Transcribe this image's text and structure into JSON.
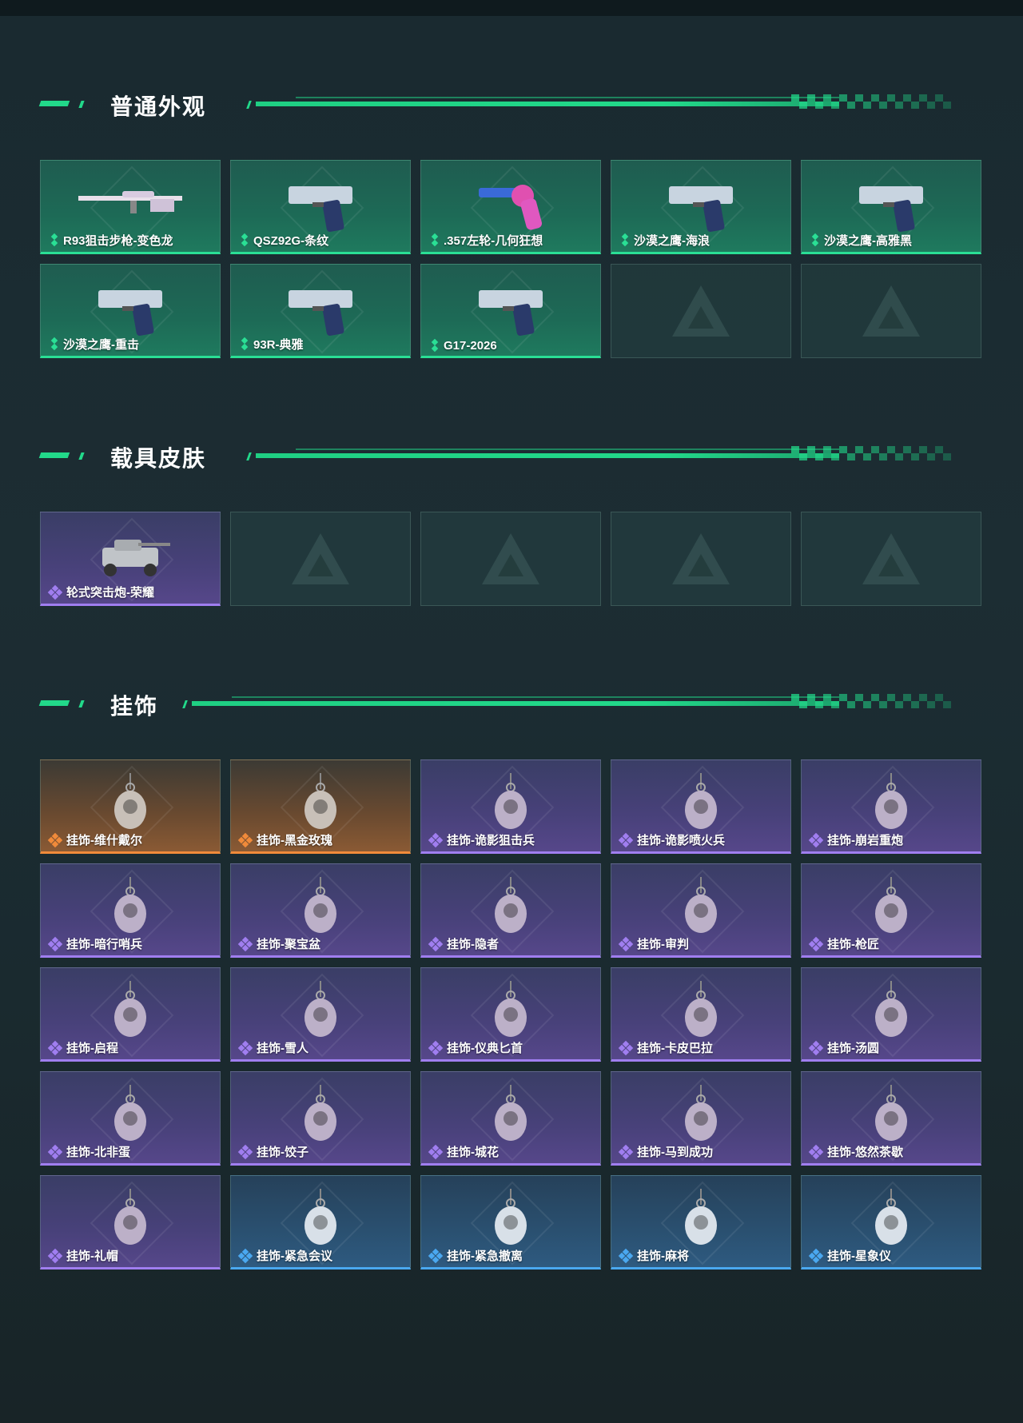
{
  "sections": {
    "weapon": {
      "title": "普通外观",
      "items": [
        {
          "label": "R93狙击步枪-变色龙",
          "rarity": "green",
          "icon": "sniper-rifle-icon"
        },
        {
          "label": "QSZ92G-条纹",
          "rarity": "green",
          "icon": "pistol-icon"
        },
        {
          "label": ".357左轮-几何狂想",
          "rarity": "green",
          "icon": "revolver-icon"
        },
        {
          "label": "沙漠之鹰-海浪",
          "rarity": "green",
          "icon": "pistol-icon"
        },
        {
          "label": "沙漠之鹰-高雅黑",
          "rarity": "green",
          "icon": "pistol-icon"
        },
        {
          "label": "沙漠之鹰-重击",
          "rarity": "green",
          "icon": "pistol-icon"
        },
        {
          "label": "93R-典雅",
          "rarity": "green",
          "icon": "pistol-icon"
        },
        {
          "label": "G17-2026",
          "rarity": "green",
          "icon": "pistol-icon"
        }
      ],
      "empty_slots": 2
    },
    "vehicle": {
      "title": "载具皮肤",
      "items": [
        {
          "label": "轮式突击炮-荣耀",
          "rarity": "purple",
          "icon": "vehicle-icon"
        }
      ],
      "empty_slots": 4
    },
    "charm": {
      "title": "挂饰",
      "items": [
        {
          "label": "挂饰-维什戴尔",
          "rarity": "orange",
          "icon": "charm-icon"
        },
        {
          "label": "挂饰-黑金玫瑰",
          "rarity": "orange",
          "icon": "charm-icon"
        },
        {
          "label": "挂饰-诡影狙击兵",
          "rarity": "purple",
          "icon": "charm-icon"
        },
        {
          "label": "挂饰-诡影喷火兵",
          "rarity": "purple",
          "icon": "charm-icon"
        },
        {
          "label": "挂饰-崩岩重炮",
          "rarity": "purple",
          "icon": "charm-icon"
        },
        {
          "label": "挂饰-暗行哨兵",
          "rarity": "purple",
          "icon": "charm-icon"
        },
        {
          "label": "挂饰-聚宝盆",
          "rarity": "purple",
          "icon": "charm-icon"
        },
        {
          "label": "挂饰-隐者",
          "rarity": "purple",
          "icon": "charm-icon"
        },
        {
          "label": "挂饰-审判",
          "rarity": "purple",
          "icon": "charm-icon"
        },
        {
          "label": "挂饰-枪匠",
          "rarity": "purple",
          "icon": "charm-icon"
        },
        {
          "label": "挂饰-启程",
          "rarity": "purple",
          "icon": "charm-icon"
        },
        {
          "label": "挂饰-雪人",
          "rarity": "purple",
          "icon": "charm-icon"
        },
        {
          "label": "挂饰-仪典匕首",
          "rarity": "purple",
          "icon": "charm-icon"
        },
        {
          "label": "挂饰-卡皮巴拉",
          "rarity": "purple",
          "icon": "charm-icon"
        },
        {
          "label": "挂饰-汤圆",
          "rarity": "purple",
          "icon": "charm-icon"
        },
        {
          "label": "挂饰-北非蛋",
          "rarity": "purple",
          "icon": "charm-icon"
        },
        {
          "label": "挂饰-饺子",
          "rarity": "purple",
          "icon": "charm-icon"
        },
        {
          "label": "挂饰-城花",
          "rarity": "purple",
          "icon": "charm-icon"
        },
        {
          "label": "挂饰-马到成功",
          "rarity": "purple",
          "icon": "charm-icon"
        },
        {
          "label": "挂饰-悠然茶歇",
          "rarity": "purple",
          "icon": "charm-icon"
        },
        {
          "label": "挂饰-礼帽",
          "rarity": "purple",
          "icon": "charm-icon"
        },
        {
          "label": "挂饰-紧急会议",
          "rarity": "blue",
          "icon": "charm-icon"
        },
        {
          "label": "挂饰-紧急撤离",
          "rarity": "blue",
          "icon": "charm-icon"
        },
        {
          "label": "挂饰-麻将",
          "rarity": "blue",
          "icon": "charm-icon"
        },
        {
          "label": "挂饰-星象仪",
          "rarity": "blue",
          "icon": "charm-icon"
        }
      ],
      "empty_slots": 0
    }
  },
  "colors": {
    "accent": "#22d98a",
    "green": "#2adf95",
    "purple": "#a07ef0",
    "orange": "#f08a3a",
    "blue": "#4aa8f0"
  }
}
